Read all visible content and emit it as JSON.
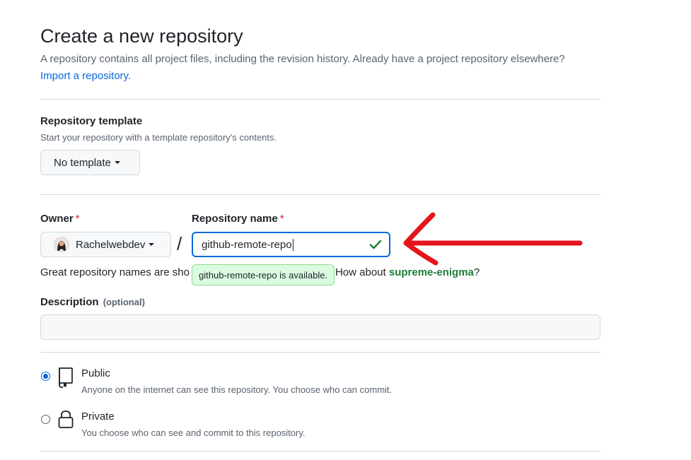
{
  "header": {
    "title": "Create a new repository",
    "intro": "A repository contains all project files, including the revision history. Already have a project repository elsewhere?",
    "import_link": "Import a repository."
  },
  "template": {
    "label": "Repository template",
    "note": "Start your repository with a template repository's contents.",
    "button": "No template"
  },
  "owner": {
    "label": "Owner",
    "required_mark": "*",
    "name": "Rachelwebdev"
  },
  "repo": {
    "label": "Repository name",
    "required_mark": "*",
    "value": "github-remote-repo",
    "separator": "/",
    "availability": "github-remote-repo is available."
  },
  "hint": {
    "prefix": "Great repository names are sho",
    "middle": "ration? How about ",
    "suggestion": "supreme-enigma",
    "suffix": "?"
  },
  "description": {
    "label": "Description",
    "optional": "(optional)",
    "value": ""
  },
  "visibility": [
    {
      "title": "Public",
      "desc": "Anyone on the internet can see this repository. You choose who can commit.",
      "selected": true,
      "icon": "repo-icon"
    },
    {
      "title": "Private",
      "desc": "You choose who can see and commit to this repository.",
      "selected": false,
      "icon": "lock-icon"
    }
  ],
  "colors": {
    "accent": "#0969da",
    "success": "#1a7f37",
    "annotation": "#e3161b"
  }
}
